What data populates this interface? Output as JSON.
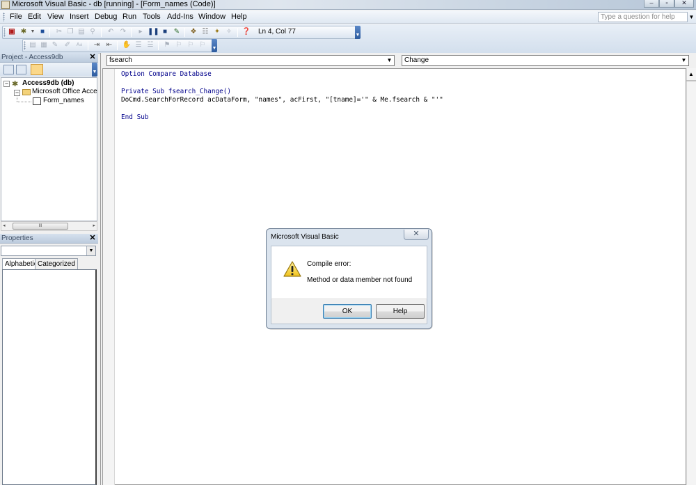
{
  "window": {
    "title": "Microsoft Visual Basic - db [running] - [Form_names (Code)]",
    "minimize_glyph": "–",
    "restore_glyph": "▫",
    "close_glyph": "✕"
  },
  "menu": {
    "items": [
      "File",
      "Edit",
      "View",
      "Insert",
      "Debug",
      "Run",
      "Tools",
      "Add-Ins",
      "Window",
      "Help"
    ],
    "help_search_placeholder": "Type a question for help"
  },
  "toolbar": {
    "position": "Ln 4, Col 77"
  },
  "project_explorer": {
    "title": "Project - Access9db",
    "tree": {
      "root": "Access9db (db)",
      "folder": "Microsoft Office Access Class Objects",
      "item": "Form_names"
    }
  },
  "properties": {
    "title": "Properties",
    "tabs": [
      "Alphabetic",
      "Categorized"
    ],
    "object_value": ""
  },
  "code_window": {
    "object_combo": "fsearch",
    "procedure_combo": "Change",
    "lines": [
      "Option Compare Database",
      "",
      "Private Sub fsearch_Change()",
      "DoCmd.SearchForRecord acDataForm, \"names\", acFirst, \"[tname]='\" & Me.fsearch & \"'\"",
      "",
      "End Sub"
    ]
  },
  "dialog": {
    "title": "Microsoft Visual Basic",
    "heading": "Compile error:",
    "message": "Method or data member not found",
    "ok_label": "OK",
    "help_label": "Help",
    "icon": "warning-icon"
  },
  "colors": {
    "code_keyword": "#00008b",
    "titlebar": "#dfe6ee",
    "dialog_frame": "#dbe4ee"
  }
}
